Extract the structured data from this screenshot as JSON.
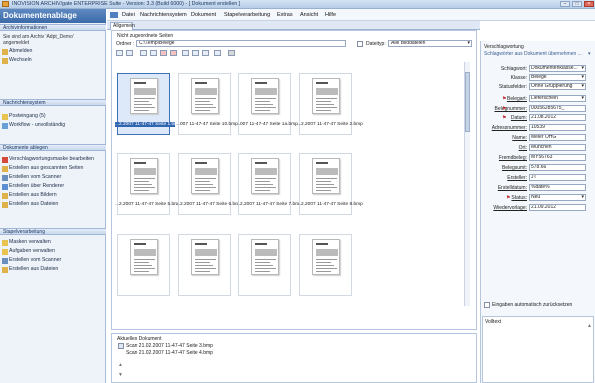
{
  "window": {
    "title": "INOVISION ARCHIV/gate ENTERPRISE Suite - Version: 3.3 (Build 6000) - [ Dokument erstellen ]",
    "min": "–",
    "max": "□",
    "close": "×"
  },
  "left": {
    "header": "Dokumentenablage",
    "sections": {
      "archiv": "Archivinformationen",
      "nachrichten": "Nachrichtensystem",
      "dokumente": "Dokumente ablegen",
      "stapel": "Stapelverarbeitung"
    },
    "archiv_text1": "Sie sind am Archiv 'Adpt_Demo'",
    "archiv_text2": "angemeldet",
    "archiv_items": [
      "Abmelden",
      "Wechseln"
    ],
    "nachrichten_items": [
      "Posteingang (5)",
      "Workflow - unvollständig"
    ],
    "dokumente_items": [
      "Verschlagwortungsmaske bearbeiten",
      "Erstellen aus gescannten Seiten",
      "Erstellen vom Scanner",
      "Erstellen über Renderer",
      "Erstellen aus Bildern",
      "Erstellen aus Dateien"
    ],
    "stapel_items": [
      "Masken verwalten",
      "Aufgaben verwalten",
      "Erstellen vom Scanner",
      "Erstellen aus Dateien"
    ]
  },
  "menubar": [
    "Datei",
    "Nachrichtensystem",
    "Dokument",
    "Stapelverarbeitung",
    "Extras",
    "Ansicht",
    "Hilfe"
  ],
  "tab": "Allgemein",
  "doc": {
    "unassigned_label": "Nicht zugeordnete Seiten",
    "folder_label": "Ordner :",
    "folder_value": "C:\\Temp\\Belege",
    "filetype_label": "Dateityp:",
    "filetype_value": "Alle Bilddateien",
    "thumbs": [
      "...2.2007 11-47-47 Seite 1.bmp",
      "...007 11-47-47 Seite 10.bmp",
      "...007 11-47-47 Seite 1a.bmp",
      "...2.2007 11-47-47 Seite 2.bmp",
      "...2.2007 11-47-47 Seite 5.bmp",
      "...2.2007 11-47-47 Seite 6.bmp",
      "...2.2007 11-47-47 Seite 7.bmp",
      "...2.2007 11-47-47 Seite 8.bmp",
      "",
      "",
      "",
      ""
    ],
    "current_label": "Aktuelles Dokument",
    "current_items": [
      "Scan 21.02.2007 11-47-47 Seite 3.bmp",
      "Scan 21.02.2007 11-47-47 Seite 4.bmp"
    ]
  },
  "right": {
    "title": "Verschlagwortung",
    "sub": "Schlagwörter aus Dokument übernehmen ...",
    "fields": [
      {
        "label": "Schlagwort:",
        "value": "Dokumentenklasse..."
      },
      {
        "label": "Klasse:",
        "value": "Belege"
      },
      {
        "label": "Statusfelder:",
        "value": "Ohne Gruppierung"
      },
      {
        "label": "Belegart:",
        "value": "Lieferschein"
      },
      {
        "label": "Belegnummer:",
        "value": "00056285675_"
      },
      {
        "label": "Datum:",
        "value": "21.08.2012"
      },
      {
        "label": "Adressnummer:",
        "value": "10539"
      },
      {
        "label": "Name:",
        "value": "Meier OHG"
      },
      {
        "label": "Ort:",
        "value": "München"
      },
      {
        "label": "Fremdbeleg:",
        "value": "MY56763"
      },
      {
        "label": "Belegsumt:",
        "value": "578.66"
      },
      {
        "label": "Ersteller:",
        "value": "JT"
      },
      {
        "label": "Erstelldatum:",
        "value": "%date%"
      },
      {
        "label": "Status:",
        "value": "Neu"
      },
      {
        "label": "Wiedervorlage:",
        "value": "21.09.2012"
      }
    ],
    "auto_reset": "Eingaben automatisch zurücksetzen",
    "voll_label": "Volltext"
  }
}
